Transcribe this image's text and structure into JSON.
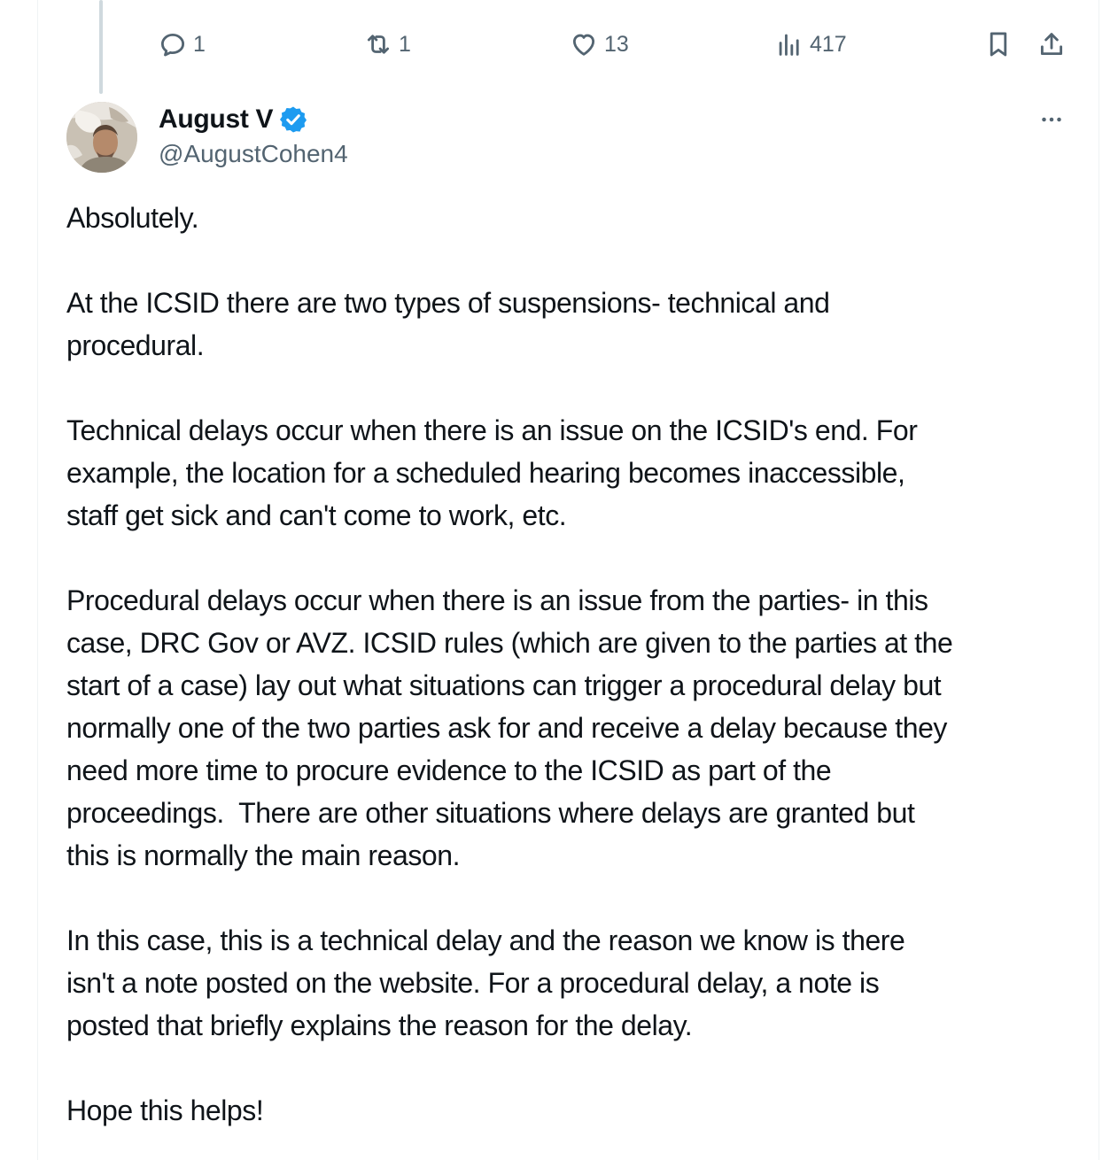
{
  "actions": {
    "reply_count": "1",
    "repost_count": "1",
    "like_count": "13",
    "view_count": "417"
  },
  "author": {
    "display_name": "August V",
    "handle": "@AugustCohen4",
    "verified": true
  },
  "tweet": {
    "paragraphs": [
      "Absolutely.",
      "At the ICSID there are two types of suspensions- technical and\nprocedural.",
      "Technical delays occur when there is an issue on the ICSID's end. For\nexample, the location for a scheduled hearing becomes inaccessible,\nstaff get sick and can't come to work, etc.",
      "Procedural delays occur when there is an issue from the parties- in this\ncase, DRC Gov or AVZ. ICSID rules (which are given to the parties at the\nstart of a case) lay out what situations can trigger a procedural delay but\nnormally one of the two parties ask for and receive a delay because they\nneed more time to procure evidence to the ICSID as part of the\nproceedings.  There are other situations where delays are granted but\nthis is normally the main reason.",
      "In this case, this is a technical delay and the reason we know is there\nisn't a note posted on the website. For a procedural delay, a note is\nposted that briefly explains the reason for the delay.",
      "Hope this helps!"
    ]
  },
  "icons": {
    "reply": "reply-icon",
    "repost": "repost-icon",
    "like": "heart-icon",
    "views": "views-icon",
    "bookmark": "bookmark-icon",
    "share": "share-icon",
    "more": "more-icon",
    "verified": "verified-badge-icon"
  },
  "colors": {
    "text_primary": "#0f1419",
    "text_secondary": "#536471",
    "verified_blue": "#1d9bf0",
    "thread_line": "#cfd9de"
  }
}
